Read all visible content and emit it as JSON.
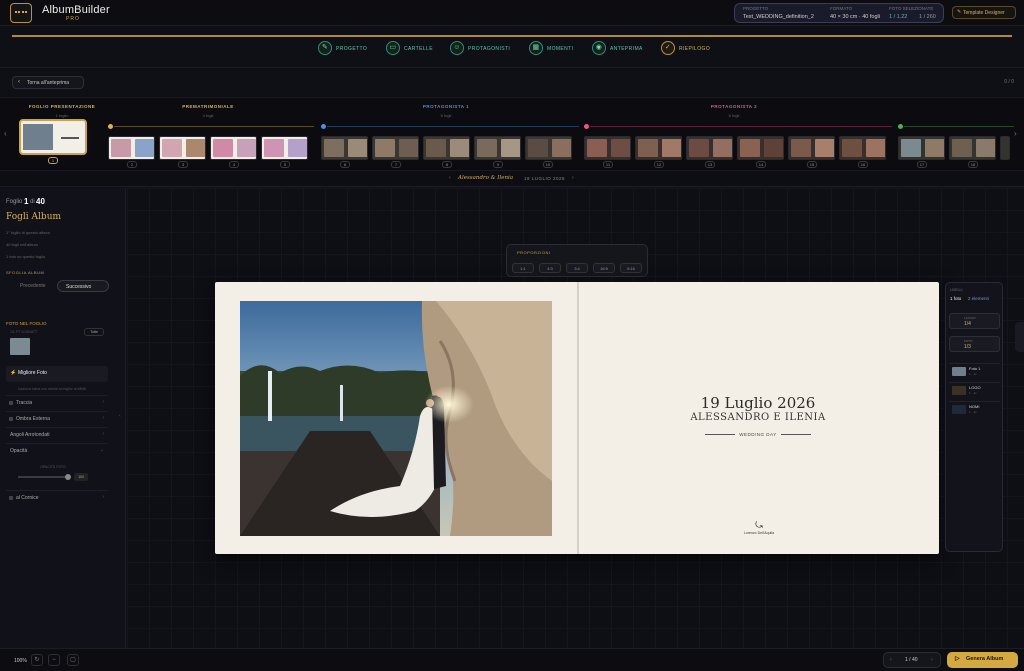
{
  "app": {
    "name": "AlbumBuilder",
    "edition": "PRO"
  },
  "header": {
    "project_label": "PROGETTO",
    "project_value": "Test_WEDDING_definition_2",
    "format_label": "FORMATO",
    "format_value": "40 × 30 cm · 40 fogli",
    "photos_label": "FOTO SELEZIONATE",
    "photos_used": "1 / 1.22",
    "photos_total": "1 / 260",
    "template_button": "Template Designer"
  },
  "steps": [
    {
      "label": "PROGETTO",
      "icon": "pencil-icon"
    },
    {
      "label": "CARTELLE",
      "icon": "folder-icon"
    },
    {
      "label": "PROTAGONISTI",
      "icon": "user-icon"
    },
    {
      "label": "MOMENTI",
      "icon": "calendar-icon"
    },
    {
      "label": "ANTEPRIMA",
      "icon": "eye-icon"
    },
    {
      "label": "RIEPILOGO",
      "icon": "check-icon"
    }
  ],
  "back_button": "Torna all'anteprima",
  "page_count": "0 / 0",
  "strip": {
    "sections": [
      {
        "title": "FOGLIO PRESENTAZIONE",
        "sub": "1 foglio",
        "color": "#d6b25c"
      },
      {
        "title": "PREMATRIMONIALE",
        "sub": "4 fogli",
        "color": "#d6b25c"
      },
      {
        "title": "PROTAGONISTA 1",
        "sub": "6 fogli",
        "color": "#4a90e2"
      },
      {
        "title": "PROTAGONISTA 2",
        "sub": "6 fogli",
        "color": "#e05a8a"
      }
    ],
    "numbers": [
      "1",
      "2",
      "3",
      "4",
      "5",
      "6",
      "7",
      "8",
      "9",
      "10",
      "11",
      "12",
      "13",
      "14",
      "15",
      "16",
      "17",
      "18"
    ]
  },
  "title_bar": {
    "names": "Alessandro & Ilenia",
    "date": "19 LUGLIO 2026"
  },
  "sidebar": {
    "sheet_prefix": "Foglio",
    "sheet_current": "1",
    "sheet_of": "di",
    "sheet_total": "40",
    "section_title": "Fogli Album",
    "line1": "1° foglio di questo album",
    "line2": "40 fogli nell'album",
    "line3": "1 foto su questo foglio",
    "nav_label": "SFOGLIA ALBUM",
    "prev": "Precedente",
    "next": "Successivo",
    "photos_title": "FOTO NEL FOGLIO",
    "photos_count": "1/1 FT 1/1/54ATT",
    "photos_all": "Tutte",
    "best_photo": "Migliore Foto",
    "best_sub": "Usa/una stima con servizi al miglior ai effetti",
    "rows": [
      "Traccia",
      "Ombra Esterna",
      "Angoli Arrotondati",
      "Opacità"
    ],
    "opacity_label": "OPACITÀ FOTO",
    "opacity_value": "100",
    "bottom_row": "al Cornice"
  },
  "properties": {
    "title": "PROPORZIONI",
    "ratios": [
      "1:1",
      "4:3",
      "3:4",
      "16:9",
      "9:16"
    ]
  },
  "spread": {
    "date": "19 Luglio 2026",
    "names": "ALESSANDRO E ILENIA",
    "tagline": "WEDDING DAY",
    "studio": "Lorenzo Dell'Aquila"
  },
  "right_panel": {
    "title": "LIVELLI",
    "photo_count": "1 foto",
    "element_count": "2 elementi",
    "layout_label": "LAYOUT",
    "layout_value": "1/4",
    "slots_label": "FOTO",
    "slots_value": "1/3",
    "layers": [
      {
        "name": "Foto 1",
        "sub": "1 · 1x"
      },
      {
        "name": "LOGO",
        "sub": "1 · 1x"
      },
      {
        "name": "NOMI",
        "sub": "1 · 1x"
      }
    ]
  },
  "bottom": {
    "zoom": "100%",
    "pager": "1 / 40",
    "generate": "Genera Album"
  },
  "colors": {
    "accent": "#d4a940",
    "step_green": "#5fc6a5",
    "blue": "#4a90e2",
    "pink": "#e05a8a",
    "green": "#4caf50"
  }
}
